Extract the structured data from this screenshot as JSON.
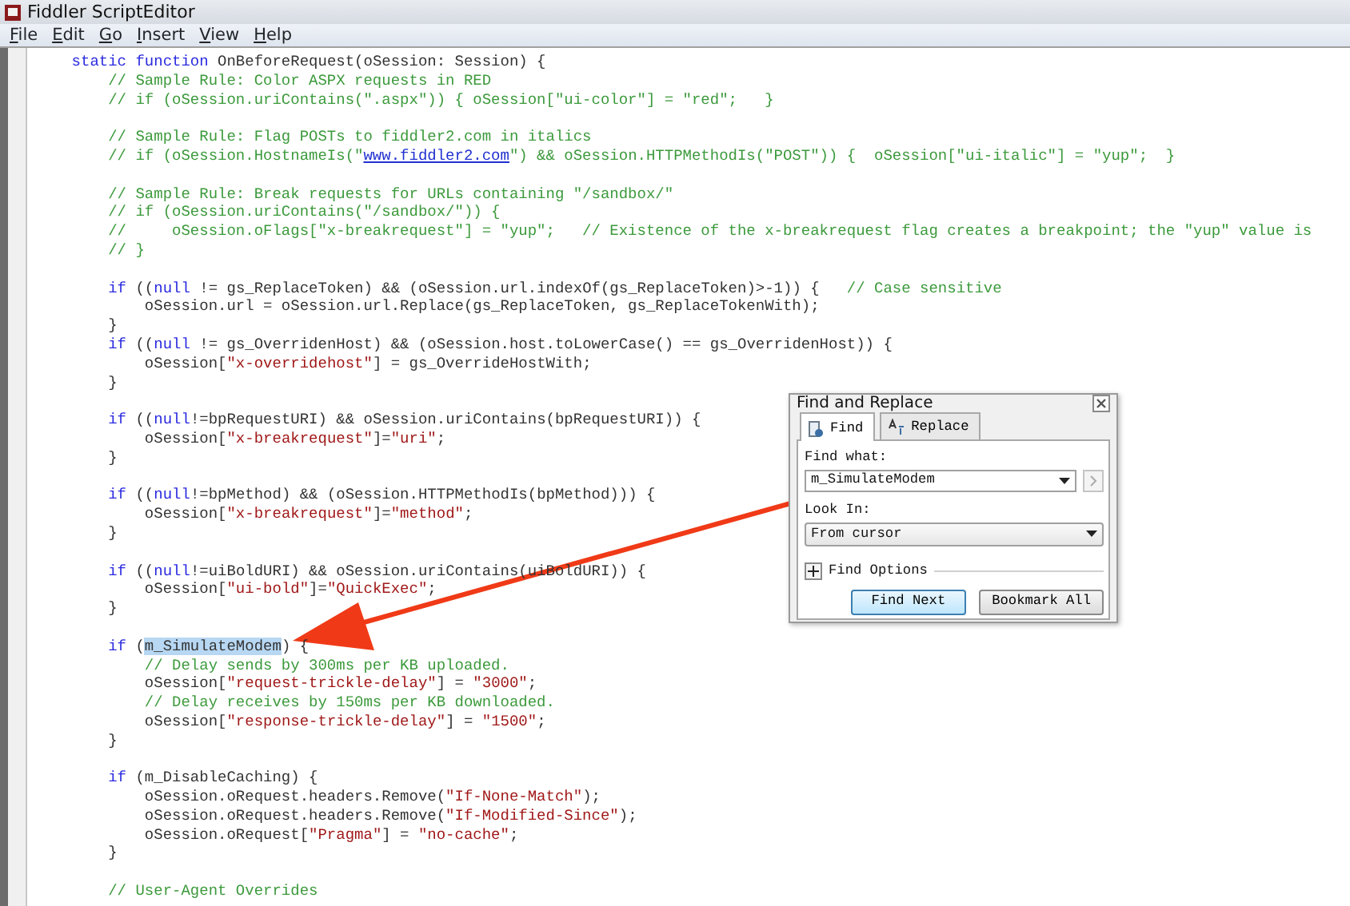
{
  "window": {
    "title": "Fiddler ScriptEditor"
  },
  "menu": [
    {
      "label": "File"
    },
    {
      "label": "Edit"
    },
    {
      "label": "Go"
    },
    {
      "label": "Insert"
    },
    {
      "label": "View"
    },
    {
      "label": "Help"
    }
  ],
  "code_lines": [
    {
      "kind": "code",
      "segments": [
        {
          "kind": "kw",
          "text": "    static function"
        },
        {
          "kind": "tx",
          "text": " OnBeforeRequest(oSession: Session) {"
        }
      ]
    },
    {
      "kind": "code",
      "segments": [
        {
          "kind": "cm",
          "text": "        // Sample Rule: Color ASPX requests in RED"
        }
      ]
    },
    {
      "kind": "code",
      "segments": [
        {
          "kind": "cm",
          "text": "        // if (oSession.uriContains(\".aspx\")) { oSession[\"ui-color\"] = \"red\";   }"
        }
      ]
    },
    {
      "kind": "blank"
    },
    {
      "kind": "code",
      "segments": [
        {
          "kind": "cm",
          "text": "        // Sample Rule: Flag POSTs to fiddler2.com in italics"
        }
      ]
    },
    {
      "kind": "code",
      "segments": [
        {
          "kind": "cm",
          "text": "        // if (oSession.HostnameIs(\""
        },
        {
          "kind": "link",
          "text": "www.fiddler2.com"
        },
        {
          "kind": "cm",
          "text": "\") && oSession.HTTPMethodIs(\"POST\")) {  oSession[\"ui-italic\"] = \"yup\";  }"
        }
      ]
    },
    {
      "kind": "blank"
    },
    {
      "kind": "code",
      "segments": [
        {
          "kind": "cm",
          "text": "        // Sample Rule: Break requests for URLs containing \"/sandbox/\""
        }
      ]
    },
    {
      "kind": "code",
      "segments": [
        {
          "kind": "cm",
          "text": "        // if (oSession.uriContains(\"/sandbox/\")) {"
        }
      ]
    },
    {
      "kind": "code",
      "segments": [
        {
          "kind": "cm",
          "text": "        //     oSession.oFlags[\"x-breakrequest\"] = \"yup\";   // Existence of the x-breakrequest flag creates a breakpoint; the \"yup\" value is"
        }
      ]
    },
    {
      "kind": "code",
      "segments": [
        {
          "kind": "cm",
          "text": "        // }"
        }
      ]
    },
    {
      "kind": "blank"
    },
    {
      "kind": "code",
      "segments": [
        {
          "kind": "kw",
          "text": "        if"
        },
        {
          "kind": "tx",
          "text": " (("
        },
        {
          "kind": "kw",
          "text": "null"
        },
        {
          "kind": "tx",
          "text": " != gs_ReplaceToken) && (oSession.url.indexOf(gs_ReplaceToken)>-1)) {   "
        },
        {
          "kind": "cm",
          "text": "// Case sensitive"
        }
      ]
    },
    {
      "kind": "code",
      "segments": [
        {
          "kind": "tx",
          "text": "            oSession.url = oSession.url.Replace(gs_ReplaceToken, gs_ReplaceTokenWith);"
        }
      ]
    },
    {
      "kind": "code",
      "segments": [
        {
          "kind": "tx",
          "text": "        }"
        }
      ]
    },
    {
      "kind": "code",
      "segments": [
        {
          "kind": "kw",
          "text": "        if"
        },
        {
          "kind": "tx",
          "text": " (("
        },
        {
          "kind": "kw",
          "text": "null"
        },
        {
          "kind": "tx",
          "text": " != gs_OverridenHost) && (oSession.host.toLowerCase() == gs_OverridenHost)) {"
        }
      ]
    },
    {
      "kind": "code",
      "segments": [
        {
          "kind": "tx",
          "text": "            oSession["
        },
        {
          "kind": "str",
          "text": "\"x-overridehost\""
        },
        {
          "kind": "tx",
          "text": "] = gs_OverrideHostWith;"
        }
      ]
    },
    {
      "kind": "code",
      "segments": [
        {
          "kind": "tx",
          "text": "        }"
        }
      ]
    },
    {
      "kind": "blank"
    },
    {
      "kind": "code",
      "segments": [
        {
          "kind": "kw",
          "text": "        if"
        },
        {
          "kind": "tx",
          "text": " (("
        },
        {
          "kind": "kw",
          "text": "null"
        },
        {
          "kind": "tx",
          "text": "!=bpRequestURI) && oSession.uriContains(bpRequestURI)) {"
        }
      ]
    },
    {
      "kind": "code",
      "segments": [
        {
          "kind": "tx",
          "text": "            oSession["
        },
        {
          "kind": "str",
          "text": "\"x-breakrequest\""
        },
        {
          "kind": "tx",
          "text": "]="
        },
        {
          "kind": "str",
          "text": "\"uri\""
        },
        {
          "kind": "tx",
          "text": ";"
        }
      ]
    },
    {
      "kind": "code",
      "segments": [
        {
          "kind": "tx",
          "text": "        }"
        }
      ]
    },
    {
      "kind": "blank"
    },
    {
      "kind": "code",
      "segments": [
        {
          "kind": "kw",
          "text": "        if"
        },
        {
          "kind": "tx",
          "text": " (("
        },
        {
          "kind": "kw",
          "text": "null"
        },
        {
          "kind": "tx",
          "text": "!=bpMethod) && (oSession.HTTPMethodIs(bpMethod))) {"
        }
      ]
    },
    {
      "kind": "code",
      "segments": [
        {
          "kind": "tx",
          "text": "            oSession["
        },
        {
          "kind": "str",
          "text": "\"x-breakrequest\""
        },
        {
          "kind": "tx",
          "text": "]="
        },
        {
          "kind": "str",
          "text": "\"method\""
        },
        {
          "kind": "tx",
          "text": ";"
        }
      ]
    },
    {
      "kind": "code",
      "segments": [
        {
          "kind": "tx",
          "text": "        }"
        }
      ]
    },
    {
      "kind": "blank"
    },
    {
      "kind": "code",
      "segments": [
        {
          "kind": "kw",
          "text": "        if"
        },
        {
          "kind": "tx",
          "text": " (("
        },
        {
          "kind": "kw",
          "text": "null"
        },
        {
          "kind": "tx",
          "text": "!=uiBoldURI) && oSession.uriContains(uiBoldURI)) {"
        }
      ]
    },
    {
      "kind": "code",
      "segments": [
        {
          "kind": "tx",
          "text": "            oSession["
        },
        {
          "kind": "str",
          "text": "\"ui-bold\""
        },
        {
          "kind": "tx",
          "text": "]="
        },
        {
          "kind": "str",
          "text": "\"QuickExec\""
        },
        {
          "kind": "tx",
          "text": ";"
        }
      ]
    },
    {
      "kind": "code",
      "segments": [
        {
          "kind": "tx",
          "text": "        }"
        }
      ]
    },
    {
      "kind": "blank"
    },
    {
      "kind": "code",
      "segments": [
        {
          "kind": "kw",
          "text": "        if"
        },
        {
          "kind": "tx",
          "text": " ("
        },
        {
          "kind": "hit",
          "text": "m_SimulateModem"
        },
        {
          "kind": "tx",
          "text": ") {"
        }
      ]
    },
    {
      "kind": "code",
      "segments": [
        {
          "kind": "cm",
          "text": "            // Delay sends by 300ms per KB uploaded."
        }
      ]
    },
    {
      "kind": "code",
      "segments": [
        {
          "kind": "tx",
          "text": "            oSession["
        },
        {
          "kind": "str",
          "text": "\"request-trickle-delay\""
        },
        {
          "kind": "tx",
          "text": "] = "
        },
        {
          "kind": "str",
          "text": "\"3000\""
        },
        {
          "kind": "tx",
          "text": ";"
        }
      ]
    },
    {
      "kind": "code",
      "segments": [
        {
          "kind": "cm",
          "text": "            // Delay receives by 150ms per KB downloaded."
        }
      ]
    },
    {
      "kind": "code",
      "segments": [
        {
          "kind": "tx",
          "text": "            oSession["
        },
        {
          "kind": "str",
          "text": "\"response-trickle-delay\""
        },
        {
          "kind": "tx",
          "text": "] = "
        },
        {
          "kind": "str",
          "text": "\"1500\""
        },
        {
          "kind": "tx",
          "text": ";"
        }
      ]
    },
    {
      "kind": "code",
      "segments": [
        {
          "kind": "tx",
          "text": "        }"
        }
      ]
    },
    {
      "kind": "blank"
    },
    {
      "kind": "code",
      "segments": [
        {
          "kind": "kw",
          "text": "        if"
        },
        {
          "kind": "tx",
          "text": " (m_DisableCaching) {"
        }
      ]
    },
    {
      "kind": "code",
      "segments": [
        {
          "kind": "tx",
          "text": "            oSession.oRequest.headers.Remove("
        },
        {
          "kind": "str",
          "text": "\"If-None-Match\""
        },
        {
          "kind": "tx",
          "text": ");"
        }
      ]
    },
    {
      "kind": "code",
      "segments": [
        {
          "kind": "tx",
          "text": "            oSession.oRequest.headers.Remove("
        },
        {
          "kind": "str",
          "text": "\"If-Modified-Since\""
        },
        {
          "kind": "tx",
          "text": ");"
        }
      ]
    },
    {
      "kind": "code",
      "segments": [
        {
          "kind": "tx",
          "text": "            oSession.oRequest["
        },
        {
          "kind": "str",
          "text": "\"Pragma\""
        },
        {
          "kind": "tx",
          "text": "] = "
        },
        {
          "kind": "str",
          "text": "\"no-cache\""
        },
        {
          "kind": "tx",
          "text": ";"
        }
      ]
    },
    {
      "kind": "code",
      "segments": [
        {
          "kind": "tx",
          "text": "        }"
        }
      ]
    },
    {
      "kind": "blank"
    },
    {
      "kind": "code",
      "segments": [
        {
          "kind": "cm",
          "text": "        // User-Agent Overrides"
        }
      ]
    }
  ],
  "find_dialog": {
    "title": "Find and Replace",
    "tabs": [
      {
        "label": "Find",
        "selected": true
      },
      {
        "label": "Replace",
        "selected": false
      }
    ],
    "find_what": {
      "label": "Find what:",
      "value": "m_SimulateModem"
    },
    "look_in": {
      "label": "Look In:",
      "value": "From cursor"
    },
    "options": {
      "label": "Find Options",
      "expanded": false
    },
    "buttons": [
      {
        "label": "Find Next",
        "default": true
      },
      {
        "label": "Bookmark All",
        "default": false
      }
    ]
  }
}
